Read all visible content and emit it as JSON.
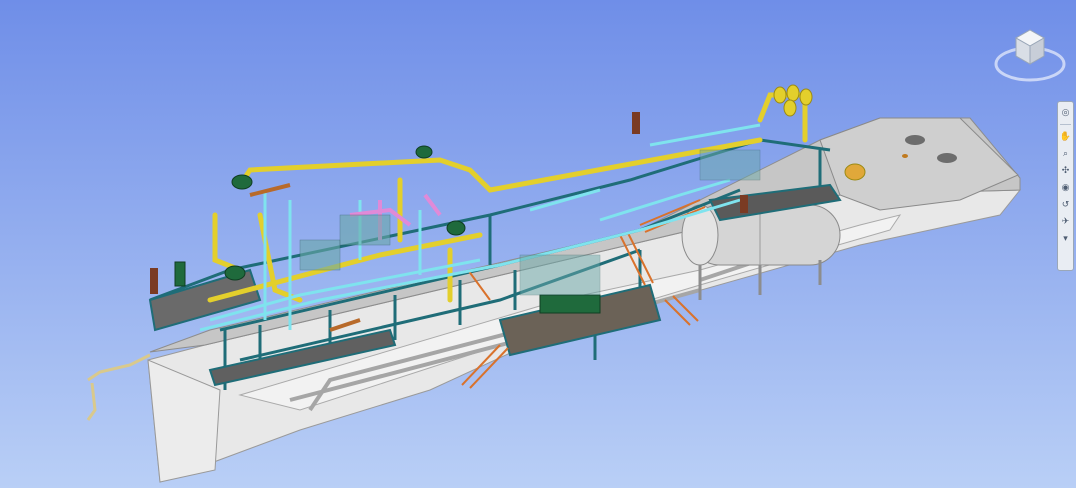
{
  "scene": {
    "background_top": "#6f8ee8",
    "background_bottom": "#b9cff6",
    "hull_color": "#e6e6e6",
    "deck_color": "#c2c2c2",
    "structure_teal": "#1f6d78",
    "pipe_yellow": "#e3cf2c",
    "pipe_cyan": "#7fe3ee",
    "pipe_pink": "#e08ad8",
    "tank_color": "#d7d7d7",
    "stair_orange": "#d9722c",
    "equipment_green": "#1f6a3c"
  },
  "view_cube": {
    "icon": "view-cube-icon"
  },
  "nav_bar": {
    "tools": [
      {
        "icon": "steering-wheel-icon",
        "glyph": "◎"
      },
      {
        "icon": "pan-hand-icon",
        "glyph": "✋"
      },
      {
        "icon": "zoom-icon",
        "glyph": "⌕"
      },
      {
        "icon": "orbit-icon",
        "glyph": "✣"
      },
      {
        "icon": "look-icon",
        "glyph": "◉"
      },
      {
        "icon": "walk-icon",
        "glyph": "↺"
      },
      {
        "icon": "fly-icon",
        "glyph": "✈"
      },
      {
        "icon": "navbar-menu-icon",
        "glyph": "▾"
      }
    ]
  }
}
